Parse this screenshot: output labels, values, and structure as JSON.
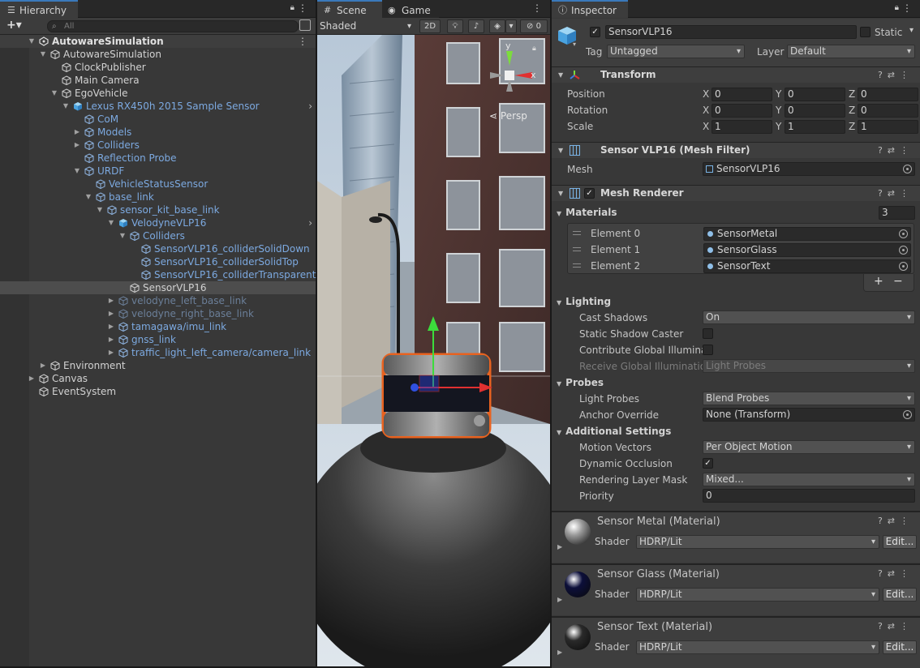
{
  "hierarchy": {
    "tab_label": "Hierarchy",
    "search_placeholder": "All",
    "add_label": "+▾",
    "rows": [
      {
        "label": "AutowareSimulation",
        "depth": 0,
        "style": "bold",
        "arrow": "down",
        "icon": "scene"
      },
      {
        "label": "AutowareSimulation",
        "depth": 1,
        "style": "white",
        "arrow": "down",
        "icon": "cube"
      },
      {
        "label": "ClockPublisher",
        "depth": 2,
        "style": "white",
        "arrow": "",
        "icon": "cube"
      },
      {
        "label": "Main Camera",
        "depth": 2,
        "style": "white",
        "arrow": "",
        "icon": "cube"
      },
      {
        "label": "EgoVehicle",
        "depth": 2,
        "style": "white",
        "arrow": "down",
        "icon": "cube"
      },
      {
        "label": "Lexus RX450h 2015 Sample Sensor",
        "depth": 3,
        "style": "blue",
        "arrow": "down",
        "icon": "prefab",
        "chev": true
      },
      {
        "label": "CoM",
        "depth": 4,
        "style": "blue",
        "arrow": "",
        "icon": "cube"
      },
      {
        "label": "Models",
        "depth": 4,
        "style": "blue",
        "arrow": "right",
        "icon": "cube"
      },
      {
        "label": "Colliders",
        "depth": 4,
        "style": "blue",
        "arrow": "right",
        "icon": "cube"
      },
      {
        "label": "Reflection Probe",
        "depth": 4,
        "style": "blue",
        "arrow": "",
        "icon": "cube"
      },
      {
        "label": "URDF",
        "depth": 4,
        "style": "blue",
        "arrow": "down",
        "icon": "cube"
      },
      {
        "label": "VehicleStatusSensor",
        "depth": 5,
        "style": "blue",
        "arrow": "",
        "icon": "cube"
      },
      {
        "label": "base_link",
        "depth": 5,
        "style": "blue",
        "arrow": "down",
        "icon": "cube"
      },
      {
        "label": "sensor_kit_base_link",
        "depth": 6,
        "style": "blue",
        "arrow": "down",
        "icon": "cube"
      },
      {
        "label": "VelodyneVLP16",
        "depth": 7,
        "style": "blue",
        "arrow": "down",
        "icon": "prefab",
        "chev": true
      },
      {
        "label": "Colliders",
        "depth": 8,
        "style": "blue",
        "arrow": "down",
        "icon": "cube"
      },
      {
        "label": "SensorVLP16_colliderSolidDown",
        "depth": 9,
        "style": "blue",
        "arrow": "",
        "icon": "cube"
      },
      {
        "label": "SensorVLP16_colliderSolidTop",
        "depth": 9,
        "style": "blue",
        "arrow": "",
        "icon": "cube"
      },
      {
        "label": "SensorVLP16_colliderTransparent",
        "depth": 9,
        "style": "blue",
        "arrow": "",
        "icon": "cube"
      },
      {
        "label": "SensorVLP16",
        "depth": 8,
        "style": "white",
        "arrow": "",
        "icon": "cube",
        "selected": true
      },
      {
        "label": "velodyne_left_base_link",
        "depth": 7,
        "style": "dim",
        "arrow": "right",
        "icon": "cube"
      },
      {
        "label": "velodyne_right_base_link",
        "depth": 7,
        "style": "dim",
        "arrow": "right",
        "icon": "cube"
      },
      {
        "label": "tamagawa/imu_link",
        "depth": 7,
        "style": "blue",
        "arrow": "right",
        "icon": "cube"
      },
      {
        "label": "gnss_link",
        "depth": 7,
        "style": "blue",
        "arrow": "right",
        "icon": "cube"
      },
      {
        "label": "traffic_light_left_camera/camera_link",
        "depth": 7,
        "style": "blue",
        "arrow": "right",
        "icon": "cube"
      },
      {
        "label": "Environment",
        "depth": 1,
        "style": "white",
        "arrow": "right",
        "icon": "cube"
      },
      {
        "label": "Canvas",
        "depth": 0,
        "style": "white",
        "arrow": "right",
        "icon": "cube"
      },
      {
        "label": "EventSystem",
        "depth": 0,
        "style": "white",
        "arrow": "",
        "icon": "cube"
      }
    ]
  },
  "scene": {
    "tab_scene": "Scene",
    "tab_game": "Game",
    "shading_mode": "Shaded",
    "btn_2d": "2D",
    "hidden_count": "0",
    "gizmo_persp": "Persp",
    "axis_x": "x",
    "axis_y": "y"
  },
  "inspector": {
    "tab_label": "Inspector",
    "object_name": "SensorVLP16",
    "static_label": "Static",
    "tag_label": "Tag",
    "tag_value": "Untagged",
    "layer_label": "Layer",
    "layer_value": "Default",
    "transform": {
      "title": "Transform",
      "position_label": "Position",
      "rotation_label": "Rotation",
      "scale_label": "Scale",
      "x": "X",
      "y": "Y",
      "z": "Z",
      "position": [
        "0",
        "0",
        "0"
      ],
      "rotation": [
        "0",
        "0",
        "0"
      ],
      "scale": [
        "1",
        "1",
        "1"
      ]
    },
    "mesh_filter": {
      "title": "Sensor VLP16 (Mesh Filter)",
      "mesh_label": "Mesh",
      "mesh_value": "SensorVLP16"
    },
    "mesh_renderer": {
      "title": "Mesh Renderer",
      "materials_label": "Materials",
      "materials_count": "3",
      "elements": [
        {
          "label": "Element 0",
          "value": "SensorMetal"
        },
        {
          "label": "Element 1",
          "value": "SensorGlass"
        },
        {
          "label": "Element 2",
          "value": "SensorText"
        }
      ],
      "add": "+",
      "remove": "−",
      "lighting_label": "Lighting",
      "cast_shadows_label": "Cast Shadows",
      "cast_shadows_value": "On",
      "static_shadow_label": "Static Shadow Caster",
      "contribute_gi_label": "Contribute Global Illuminati",
      "receive_gi_label": "Receive Global Illumination",
      "receive_gi_value": "Light Probes",
      "probes_label": "Probes",
      "light_probes_label": "Light Probes",
      "light_probes_value": "Blend Probes",
      "anchor_label": "Anchor Override",
      "anchor_value": "None (Transform)",
      "additional_label": "Additional Settings",
      "motion_label": "Motion Vectors",
      "motion_value": "Per Object Motion",
      "dynamic_occ_label": "Dynamic Occlusion",
      "rlm_label": "Rendering Layer Mask",
      "rlm_value": "Mixed...",
      "priority_label": "Priority",
      "priority_value": "0"
    },
    "materials": [
      {
        "name": "Sensor Metal (Material)",
        "shader_label": "Shader",
        "shader": "HDRP/Lit",
        "edit": "Edit...",
        "color": "#9a9a9a"
      },
      {
        "name": "Sensor Glass (Material)",
        "shader_label": "Shader",
        "shader": "HDRP/Lit",
        "edit": "Edit...",
        "color": "#0c0f3a"
      },
      {
        "name": "Sensor Text (Material)",
        "shader_label": "Shader",
        "shader": "HDRP/Lit",
        "edit": "Edit...",
        "color": "#2a2a2a"
      }
    ]
  }
}
